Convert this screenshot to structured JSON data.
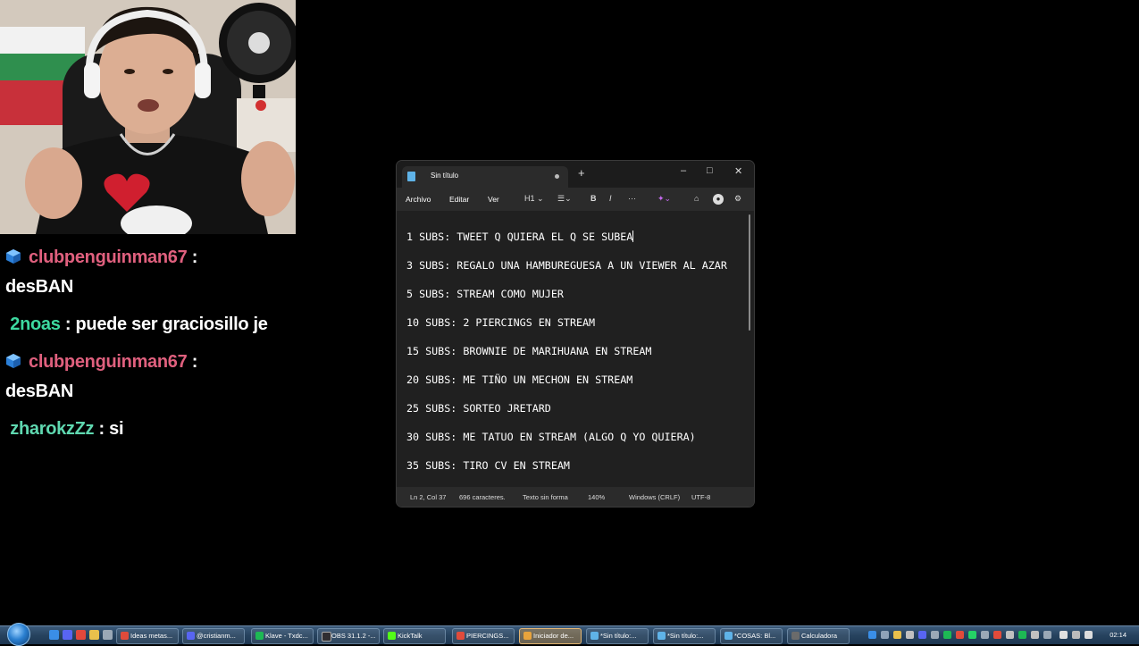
{
  "chat": {
    "messages": [
      {
        "user": "clubpenguinman67",
        "sep": ":",
        "text": "desBAN",
        "badge": "cube-badge-icon"
      },
      {
        "user": "2noas",
        "sep": ":",
        "text": "puede ser graciosillo je"
      },
      {
        "user": "clubpenguinman67",
        "sep": ":",
        "text": "desBAN",
        "badge": "cube-badge-icon"
      },
      {
        "user": "zharokzZz",
        "sep": ":",
        "text": "si"
      }
    ]
  },
  "notepad": {
    "tab_title": "Sin título",
    "new_tab": "+",
    "controls": {
      "minimize": "–",
      "maximize": "□",
      "close": "✕"
    },
    "menu": {
      "file": "Archivo",
      "edit": "Editar",
      "view": "Ver",
      "heading": "H1"
    },
    "toolbar": {
      "bold": "B",
      "italic": "I",
      "more": "···"
    },
    "lines": [
      "1 SUBS: TWEET Q QUIERA EL Q SE SUBEA",
      "3 SUBS: REGALO UNA HAMBUREGUESA A UN VIEWER AL AZAR",
      "5 SUBS: STREAM COMO MUJER",
      "10 SUBS: 2 PIERCINGS EN STREAM",
      "15 SUBS: BROWNIE DE MARIHUANA EN STREAM",
      "20 SUBS: ME TIÑO UN MECHON EN STREAM",
      "25 SUBS: SORTEO JRETARD",
      "30 SUBS: ME TATUO EN STREAM (ALGO Q YO QUIERA)",
      "35 SUBS: TIRO CV EN STREAM"
    ],
    "status": {
      "position": "Ln 2, Col 37",
      "chars": "696 caracteres.",
      "format": "Texto sin forma",
      "zoom": "140%",
      "eol": "Windows (CRLF)",
      "encoding": "UTF-8"
    }
  },
  "taskbar": {
    "buttons": [
      {
        "label": "Ideas metas...",
        "color": "#e14b3b"
      },
      {
        "label": "@cristianm...",
        "color": "#5865f2"
      },
      {
        "label": "Klave - Txdc...",
        "color": "#1db954"
      },
      {
        "label": "OBS 31.1.2 -...",
        "color": "#302e31"
      },
      {
        "label": "KickTalk",
        "color": "#53fc18"
      },
      {
        "label": "PIERCINGS...",
        "color": "#e14b3b"
      },
      {
        "label": "Iniciador de...",
        "color": "#e8a33c"
      },
      {
        "label": "*Sin título:...",
        "color": "#5fb3e8"
      },
      {
        "label": "*Sin título:...",
        "color": "#5fb3e8"
      },
      {
        "label": "*COSAS: Bl...",
        "color": "#5fb3e8"
      },
      {
        "label": "Calculadora",
        "color": "#6b6b6b"
      }
    ],
    "clock": "02:14"
  }
}
